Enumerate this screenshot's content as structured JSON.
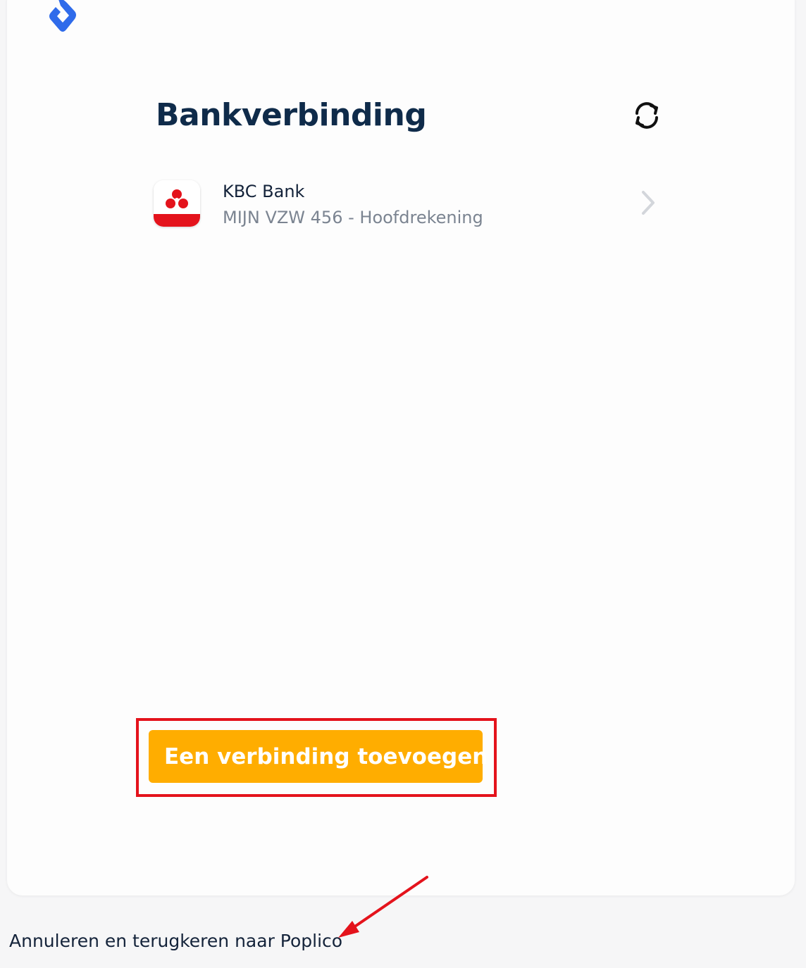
{
  "app": {
    "logo_icon": "poplico-logo-icon",
    "brand_color": "#2f6bea"
  },
  "header": {
    "title": "Bankverbinding",
    "refresh_icon": "refresh-icon"
  },
  "connections": [
    {
      "bank_name": "KBC Bank",
      "account": "MIJN VZW 456 - Hoofdrekening",
      "logo_icon": "kbc-logo-icon",
      "chevron_icon": "chevron-right-icon"
    }
  ],
  "actions": {
    "add_connection_label": "Een verbinding toevoegen",
    "button_color": "#ffad00"
  },
  "footer": {
    "cancel_link_label": "Annuleren en terugkeren naar Poplico"
  },
  "annotations": {
    "highlight_color": "#e4131c"
  }
}
